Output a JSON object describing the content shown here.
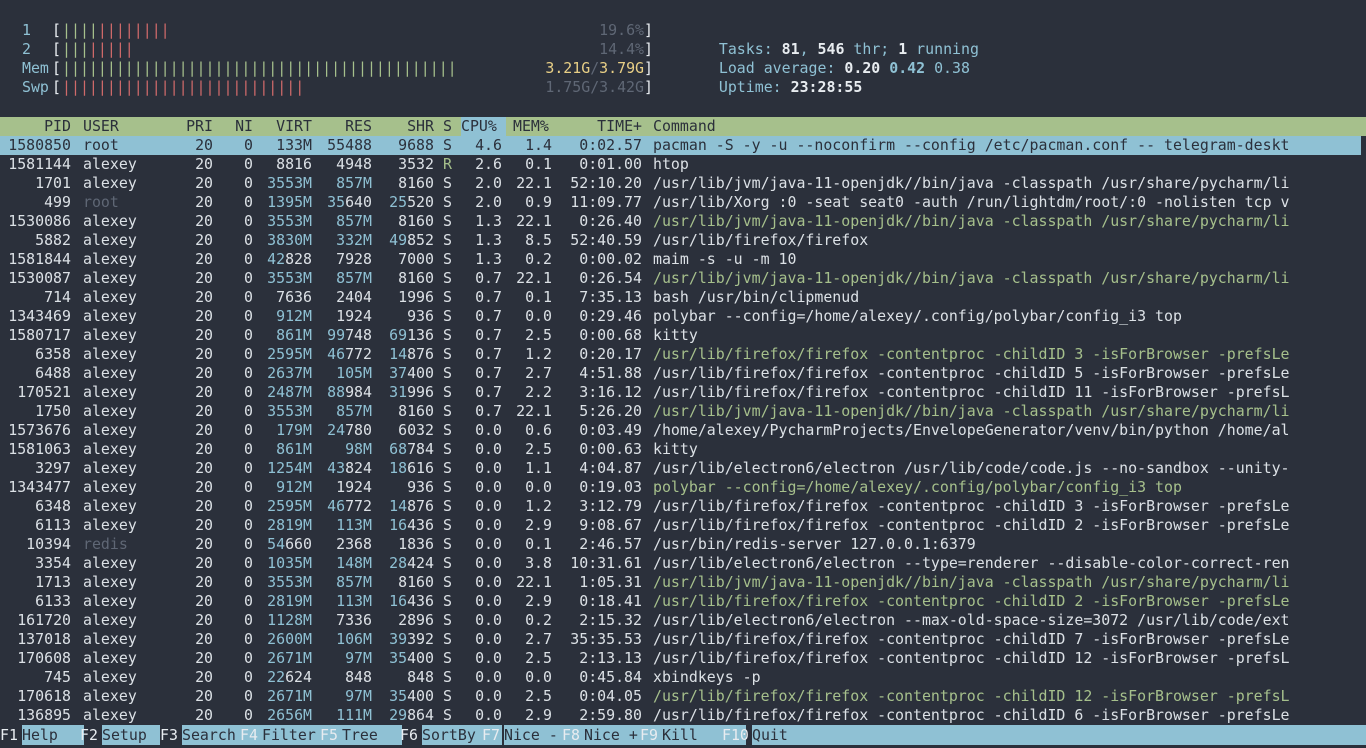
{
  "meters": {
    "cpu1": {
      "label": "1",
      "percent": "19.6%",
      "usage": 0.196
    },
    "cpu2": {
      "label": "2",
      "percent": "14.4%",
      "usage": 0.144
    },
    "mem": {
      "label": "Mem",
      "used": "3.21G",
      "slash": "/",
      "total": "3.79G",
      "usage": 0.85
    },
    "swp": {
      "label": "Swp",
      "value": "1.75G/3.42G",
      "usage": 0.51
    }
  },
  "summary": {
    "tasks_label": "Tasks:",
    "tasks": "81",
    "thr": "546",
    "thr_label": "thr;",
    "running": "1",
    "running_label": "running",
    "load_label": "Load average:",
    "load1": "0.20",
    "load5": "0.42",
    "load15": "0.38",
    "uptime_label": "Uptime:",
    "uptime": "23:28:55"
  },
  "columns": {
    "pid": "PID",
    "user": "USER",
    "pri": "PRI",
    "ni": "NI",
    "virt": "VIRT",
    "res": "RES",
    "shr": "SHR",
    "s": "S",
    "cpu": "CPU%",
    "mem": "MEM%",
    "time": "TIME+",
    "command": "Command"
  },
  "processes": [
    {
      "pid": "1580850",
      "user": "root",
      "pri": "20",
      "ni": "0",
      "virt": "133M",
      "res": "55488",
      "shr": "9688",
      "s": "S",
      "cpu": "4.6",
      "mem": "1.4",
      "time": "0:02.57",
      "command": "pacman -S -y -u --noconfirm --config /etc/pacman.conf -- telegram-deskt",
      "selected": true
    },
    {
      "pid": "1581144",
      "user": "alexey",
      "pri": "20",
      "ni": "0",
      "virt": "8816",
      "res": "4948",
      "shr": "3532",
      "s": "R",
      "cpu": "2.6",
      "mem": "0.1",
      "time": "0:01.00",
      "command": "htop"
    },
    {
      "pid": "1701",
      "user": "alexey",
      "pri": "20",
      "ni": "0",
      "virt": "3553M",
      "res": "857M",
      "shr": "8160",
      "s": "S",
      "cpu": "2.0",
      "mem": "22.1",
      "time": "52:10.20",
      "command": "/usr/lib/jvm/java-11-openjdk//bin/java -classpath /usr/share/pycharm/li"
    },
    {
      "pid": "499",
      "user": "root",
      "pri": "20",
      "ni": "0",
      "virt": "1395M",
      "res": "35640",
      "shr": "25520",
      "s": "S",
      "cpu": "2.0",
      "mem": "0.9",
      "time": "11:09.77",
      "command": "/usr/lib/Xorg :0 -seat seat0 -auth /run/lightdm/root/:0 -nolisten tcp v",
      "dimuser": true
    },
    {
      "pid": "1530086",
      "user": "alexey",
      "pri": "20",
      "ni": "0",
      "virt": "3553M",
      "res": "857M",
      "shr": "8160",
      "s": "S",
      "cpu": "1.3",
      "mem": "22.1",
      "time": "0:26.40",
      "command": "/usr/lib/jvm/java-11-openjdk//bin/java -classpath /usr/share/pycharm/li",
      "thread": true
    },
    {
      "pid": "5882",
      "user": "alexey",
      "pri": "20",
      "ni": "0",
      "virt": "3830M",
      "res": "332M",
      "shr": "49852",
      "s": "S",
      "cpu": "1.3",
      "mem": "8.5",
      "time": "52:40.59",
      "command": "/usr/lib/firefox/firefox"
    },
    {
      "pid": "1581844",
      "user": "alexey",
      "pri": "20",
      "ni": "0",
      "virt": "42828",
      "res": "7928",
      "shr": "7000",
      "s": "S",
      "cpu": "1.3",
      "mem": "0.2",
      "time": "0:00.02",
      "command": "maim -s -u -m 10"
    },
    {
      "pid": "1530087",
      "user": "alexey",
      "pri": "20",
      "ni": "0",
      "virt": "3553M",
      "res": "857M",
      "shr": "8160",
      "s": "S",
      "cpu": "0.7",
      "mem": "22.1",
      "time": "0:26.54",
      "command": "/usr/lib/jvm/java-11-openjdk//bin/java -classpath /usr/share/pycharm/li",
      "thread": true
    },
    {
      "pid": "714",
      "user": "alexey",
      "pri": "20",
      "ni": "0",
      "virt": "7636",
      "res": "2404",
      "shr": "1996",
      "s": "S",
      "cpu": "0.7",
      "mem": "0.1",
      "time": "7:35.13",
      "command": "bash /usr/bin/clipmenud"
    },
    {
      "pid": "1343469",
      "user": "alexey",
      "pri": "20",
      "ni": "0",
      "virt": "912M",
      "res": "1924",
      "shr": "936",
      "s": "S",
      "cpu": "0.7",
      "mem": "0.0",
      "time": "0:29.46",
      "command": "polybar --config=/home/alexey/.config/polybar/config_i3 top"
    },
    {
      "pid": "1580717",
      "user": "alexey",
      "pri": "20",
      "ni": "0",
      "virt": "861M",
      "res": "99748",
      "shr": "69136",
      "s": "S",
      "cpu": "0.7",
      "mem": "2.5",
      "time": "0:00.68",
      "command": "kitty"
    },
    {
      "pid": "6358",
      "user": "alexey",
      "pri": "20",
      "ni": "0",
      "virt": "2595M",
      "res": "46772",
      "shr": "14876",
      "s": "S",
      "cpu": "0.7",
      "mem": "1.2",
      "time": "0:20.17",
      "command": "/usr/lib/firefox/firefox -contentproc -childID 3 -isForBrowser -prefsLe",
      "thread": true
    },
    {
      "pid": "6488",
      "user": "alexey",
      "pri": "20",
      "ni": "0",
      "virt": "2637M",
      "res": "105M",
      "shr": "37400",
      "s": "S",
      "cpu": "0.7",
      "mem": "2.7",
      "time": "4:51.88",
      "command": "/usr/lib/firefox/firefox -contentproc -childID 5 -isForBrowser -prefsLe"
    },
    {
      "pid": "170521",
      "user": "alexey",
      "pri": "20",
      "ni": "0",
      "virt": "2487M",
      "res": "88984",
      "shr": "31996",
      "s": "S",
      "cpu": "0.7",
      "mem": "2.2",
      "time": "3:16.12",
      "command": "/usr/lib/firefox/firefox -contentproc -childID 11 -isForBrowser -prefsL"
    },
    {
      "pid": "1750",
      "user": "alexey",
      "pri": "20",
      "ni": "0",
      "virt": "3553M",
      "res": "857M",
      "shr": "8160",
      "s": "S",
      "cpu": "0.7",
      "mem": "22.1",
      "time": "5:26.20",
      "command": "/usr/lib/jvm/java-11-openjdk//bin/java -classpath /usr/share/pycharm/li",
      "thread": true
    },
    {
      "pid": "1573676",
      "user": "alexey",
      "pri": "20",
      "ni": "0",
      "virt": "179M",
      "res": "24780",
      "shr": "6032",
      "s": "S",
      "cpu": "0.0",
      "mem": "0.6",
      "time": "0:03.49",
      "command": "/home/alexey/PycharmProjects/EnvelopeGenerator/venv/bin/python /home/al"
    },
    {
      "pid": "1581063",
      "user": "alexey",
      "pri": "20",
      "ni": "0",
      "virt": "861M",
      "res": "98M",
      "shr": "68784",
      "s": "S",
      "cpu": "0.0",
      "mem": "2.5",
      "time": "0:00.63",
      "command": "kitty"
    },
    {
      "pid": "3297",
      "user": "alexey",
      "pri": "20",
      "ni": "0",
      "virt": "1254M",
      "res": "43824",
      "shr": "18616",
      "s": "S",
      "cpu": "0.0",
      "mem": "1.1",
      "time": "4:04.87",
      "command": "/usr/lib/electron6/electron /usr/lib/code/code.js --no-sandbox --unity-"
    },
    {
      "pid": "1343477",
      "user": "alexey",
      "pri": "20",
      "ni": "0",
      "virt": "912M",
      "res": "1924",
      "shr": "936",
      "s": "S",
      "cpu": "0.0",
      "mem": "0.0",
      "time": "0:19.03",
      "command": "polybar --config=/home/alexey/.config/polybar/config_i3 top",
      "thread": true
    },
    {
      "pid": "6348",
      "user": "alexey",
      "pri": "20",
      "ni": "0",
      "virt": "2595M",
      "res": "46772",
      "shr": "14876",
      "s": "S",
      "cpu": "0.0",
      "mem": "1.2",
      "time": "3:12.79",
      "command": "/usr/lib/firefox/firefox -contentproc -childID 3 -isForBrowser -prefsLe"
    },
    {
      "pid": "6113",
      "user": "alexey",
      "pri": "20",
      "ni": "0",
      "virt": "2819M",
      "res": "113M",
      "shr": "16436",
      "s": "S",
      "cpu": "0.0",
      "mem": "2.9",
      "time": "9:08.67",
      "command": "/usr/lib/firefox/firefox -contentproc -childID 2 -isForBrowser -prefsLe"
    },
    {
      "pid": "10394",
      "user": "redis",
      "pri": "20",
      "ni": "0",
      "virt": "54660",
      "res": "2368",
      "shr": "1836",
      "s": "S",
      "cpu": "0.0",
      "mem": "0.1",
      "time": "2:46.57",
      "command": "/usr/bin/redis-server 127.0.0.1:6379",
      "dimuser": true
    },
    {
      "pid": "3354",
      "user": "alexey",
      "pri": "20",
      "ni": "0",
      "virt": "1035M",
      "res": "148M",
      "shr": "28424",
      "s": "S",
      "cpu": "0.0",
      "mem": "3.8",
      "time": "10:31.61",
      "command": "/usr/lib/electron6/electron --type=renderer --disable-color-correct-ren"
    },
    {
      "pid": "1713",
      "user": "alexey",
      "pri": "20",
      "ni": "0",
      "virt": "3553M",
      "res": "857M",
      "shr": "8160",
      "s": "S",
      "cpu": "0.0",
      "mem": "22.1",
      "time": "1:05.31",
      "command": "/usr/lib/jvm/java-11-openjdk//bin/java -classpath /usr/share/pycharm/li",
      "thread": true
    },
    {
      "pid": "6133",
      "user": "alexey",
      "pri": "20",
      "ni": "0",
      "virt": "2819M",
      "res": "113M",
      "shr": "16436",
      "s": "S",
      "cpu": "0.0",
      "mem": "2.9",
      "time": "0:18.41",
      "command": "/usr/lib/firefox/firefox -contentproc -childID 2 -isForBrowser -prefsLe",
      "thread": true
    },
    {
      "pid": "161720",
      "user": "alexey",
      "pri": "20",
      "ni": "0",
      "virt": "1128M",
      "res": "7336",
      "shr": "2896",
      "s": "S",
      "cpu": "0.0",
      "mem": "0.2",
      "time": "2:15.32",
      "command": "/usr/lib/electron6/electron --max-old-space-size=3072 /usr/lib/code/ext"
    },
    {
      "pid": "137018",
      "user": "alexey",
      "pri": "20",
      "ni": "0",
      "virt": "2600M",
      "res": "106M",
      "shr": "39392",
      "s": "S",
      "cpu": "0.0",
      "mem": "2.7",
      "time": "35:35.53",
      "command": "/usr/lib/firefox/firefox -contentproc -childID 7 -isForBrowser -prefsLe"
    },
    {
      "pid": "170608",
      "user": "alexey",
      "pri": "20",
      "ni": "0",
      "virt": "2671M",
      "res": "97M",
      "shr": "35400",
      "s": "S",
      "cpu": "0.0",
      "mem": "2.5",
      "time": "2:13.13",
      "command": "/usr/lib/firefox/firefox -contentproc -childID 12 -isForBrowser -prefsL"
    },
    {
      "pid": "745",
      "user": "alexey",
      "pri": "20",
      "ni": "0",
      "virt": "22624",
      "res": "848",
      "shr": "848",
      "s": "S",
      "cpu": "0.0",
      "mem": "0.0",
      "time": "0:45.84",
      "command": "xbindkeys -p"
    },
    {
      "pid": "170618",
      "user": "alexey",
      "pri": "20",
      "ni": "0",
      "virt": "2671M",
      "res": "97M",
      "shr": "35400",
      "s": "S",
      "cpu": "0.0",
      "mem": "2.5",
      "time": "0:04.05",
      "command": "/usr/lib/firefox/firefox -contentproc -childID 12 -isForBrowser -prefsL",
      "thread": true
    },
    {
      "pid": "136895",
      "user": "alexey",
      "pri": "20",
      "ni": "0",
      "virt": "2656M",
      "res": "111M",
      "shr": "29864",
      "s": "S",
      "cpu": "0.0",
      "mem": "2.9",
      "time": "2:59.80",
      "command": "/usr/lib/firefox/firefox -contentproc -childID 6 -isForBrowser -prefsLe"
    }
  ],
  "footer": [
    {
      "key": "F1",
      "label": "Help"
    },
    {
      "key": "F2",
      "label": "Setup"
    },
    {
      "key": "F3",
      "label": "Search"
    },
    {
      "key": "F4",
      "label": "Filter"
    },
    {
      "key": "F5",
      "label": "Tree"
    },
    {
      "key": "F6",
      "label": "SortBy"
    },
    {
      "key": "F7",
      "label": "Nice -"
    },
    {
      "key": "F8",
      "label": "Nice +"
    },
    {
      "key": "F9",
      "label": "Kill"
    },
    {
      "key": "F10",
      "label": "Quit"
    }
  ],
  "colors": {
    "background": "#2b303b",
    "cyan": "#8fc1d4",
    "green": "#a6c08c",
    "red": "#d06a6a",
    "yellow": "#e8cf86"
  }
}
